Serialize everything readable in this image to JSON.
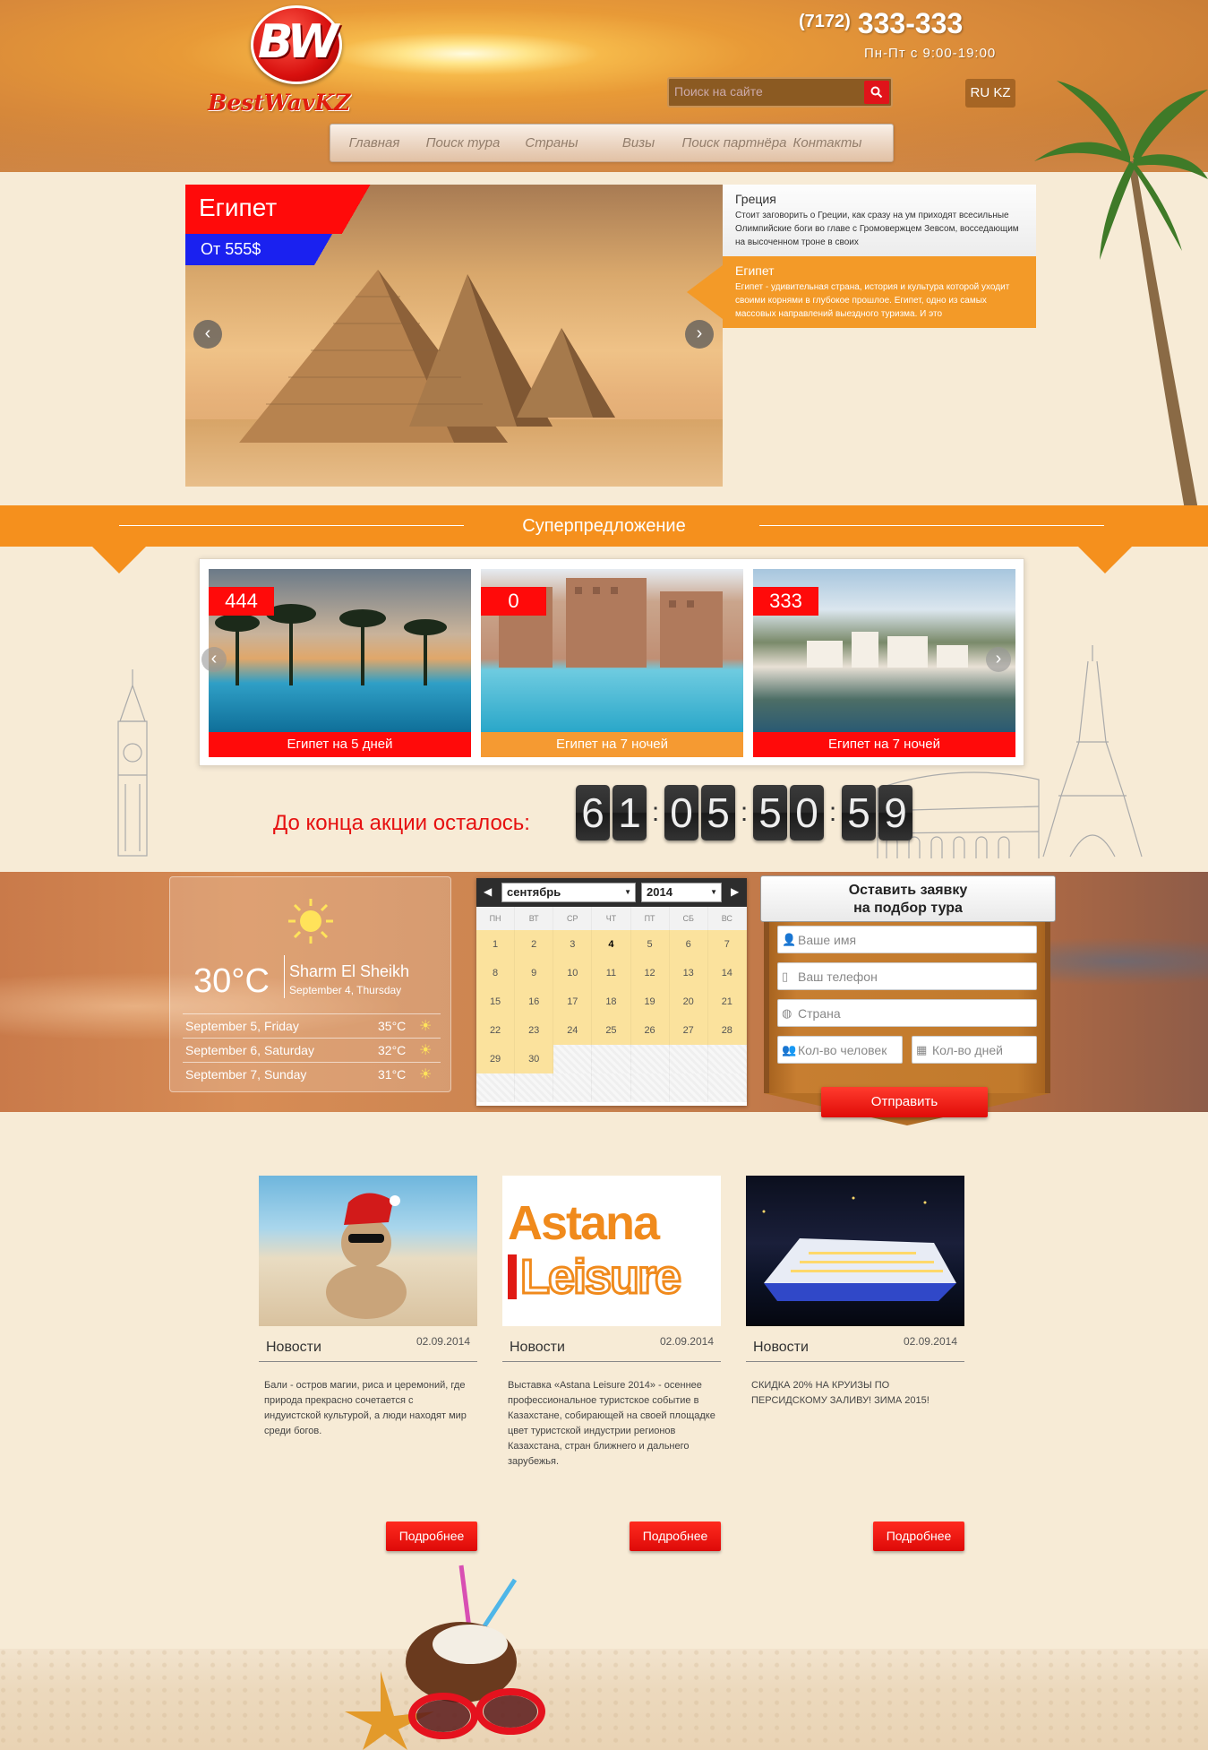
{
  "header": {
    "logo_mark": "BW",
    "logo_text": "BestWavKZ",
    "phone_code": "(7172)",
    "phone_number": "333-333",
    "hours": "Пн-Пт с 9:00-19:00",
    "search_placeholder": "Поиск на сайте",
    "lang": "RU KZ"
  },
  "nav": [
    "Главная",
    "Поиск тура",
    "Страны",
    "Визы",
    "Поиск партнёра",
    "Контакты"
  ],
  "slider": {
    "title": "Египет",
    "price": "От 555$",
    "items": [
      {
        "title": "Греция",
        "text": "Стоит заговорить о Греции, как сразу на ум приходят всесильные Олимпийские боги во главе с Громовержцем Зевсом, восседающим на высоченном троне в своих"
      },
      {
        "title": "Египет",
        "text": "Египет - удивительная страна, история и культура которой уходит своими корнями в глубокое прошлое. Египет, одно из самых массовых направлений выездного туризма. И это"
      }
    ]
  },
  "super": {
    "title": "Суперпредложение",
    "cards": [
      {
        "price": "444",
        "caption": "Египет на 5 дней"
      },
      {
        "price": "0",
        "caption": "Египет на 7 ночей"
      },
      {
        "price": "333",
        "caption": "Египет на 7 ночей"
      }
    ],
    "countdown_label": "До конца акции осталось:",
    "countdown": [
      "6",
      "1",
      "0",
      "5",
      "5",
      "0",
      "5",
      "9"
    ]
  },
  "weather": {
    "temp": "30°C",
    "city": "Sharm El Sheikh",
    "date": "September 4, Thursday",
    "forecast": [
      {
        "day": "September 5, Friday",
        "temp": "35°C"
      },
      {
        "day": "September 6, Saturday",
        "temp": "32°C"
      },
      {
        "day": "September 7, Sunday",
        "temp": "31°C"
      }
    ]
  },
  "calendar": {
    "month": "сентябрь",
    "year": "2014",
    "weekdays": [
      "ПН",
      "ВТ",
      "СР",
      "ЧТ",
      "ПТ",
      "СБ",
      "ВС"
    ],
    "days": [
      "1",
      "2",
      "3",
      "4",
      "5",
      "6",
      "7",
      "8",
      "9",
      "10",
      "11",
      "12",
      "13",
      "14",
      "15",
      "16",
      "17",
      "18",
      "19",
      "20",
      "21",
      "22",
      "23",
      "24",
      "25",
      "26",
      "27",
      "28",
      "29",
      "30"
    ],
    "today": "4"
  },
  "form": {
    "title_line1": "Оставить заявку",
    "title_line2": "на подбор тура",
    "name_placeholder": "Ваше имя",
    "phone_placeholder": "Ваш телефон",
    "country_placeholder": "Страна",
    "people_placeholder": "Кол-во человек",
    "days_placeholder": "Кол-во дней",
    "submit": "Отправить"
  },
  "news": [
    {
      "category": "Новости",
      "date": "02.09.2014",
      "text": "Бали - остров магии, риса и церемоний, где природа прекрасно сочетается с индуистской культурой, а люди находят мир среди богов.",
      "more": "Подробнее"
    },
    {
      "category": "Новости",
      "date": "02.09.2014",
      "text": "Выставка «Astana Leisure 2014» - осеннее профессиональное туристское событие в Казахстане, собирающей на своей площадке цвет туристской индустрии регионов Казахстана, стран ближнего и дальнего зарубежья.",
      "more": "Подробнее",
      "logo_line1": "Astana",
      "logo_line2": "Leisure"
    },
    {
      "category": "Новости",
      "date": "02.09.2014",
      "text": "СКИДКА 20% НА КРУИЗЫ ПО ПЕРСИДСКОМУ ЗАЛИВУ! ЗИМА 2015!",
      "more": "Подробнее"
    }
  ]
}
